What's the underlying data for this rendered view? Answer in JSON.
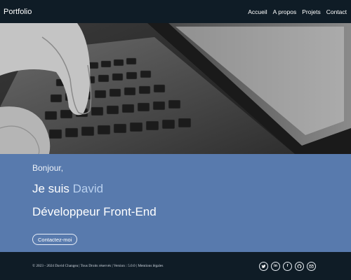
{
  "nav": {
    "brand": "Portfolio",
    "links": [
      "Accueil",
      "A propos",
      "Projets",
      "Contact"
    ]
  },
  "hero": {
    "greeting": "Bonjour,",
    "intro_prefix": "Je suis",
    "name": "David",
    "role": "Développeur Front-End",
    "cta_label": "Contactez-moi"
  },
  "footer": {
    "copyright": "© 2023 - 2024 David Changea | Tous Droits réservés | Version : 5.0.0 | Mentions légales",
    "socials": [
      "twitter-icon",
      "linkedin-icon",
      "facebook-icon",
      "github-icon",
      "email-icon"
    ]
  },
  "colors": {
    "navbar_bg": "#0f1c26",
    "hero_text_bg": "#587aad",
    "name_accent": "#b9d0ee"
  }
}
